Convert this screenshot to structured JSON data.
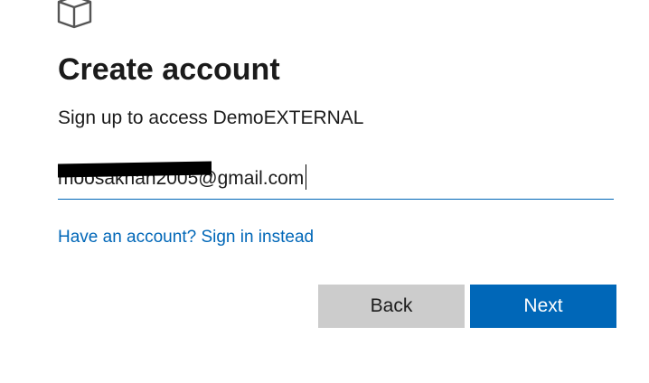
{
  "logo": {
    "icon": "cube-icon"
  },
  "heading": {
    "title": "Create account",
    "subtitle": "Sign up to access DemoEXTERNAL"
  },
  "form": {
    "email_value": "moosakhan2005@gmail.com",
    "email_redacted": true,
    "signin_link": "Have an account? Sign in instead"
  },
  "buttons": {
    "back_label": "Back",
    "next_label": "Next"
  },
  "colors": {
    "accent": "#0067b8",
    "secondary_button": "#cccccc",
    "text": "#1b1b1b"
  }
}
